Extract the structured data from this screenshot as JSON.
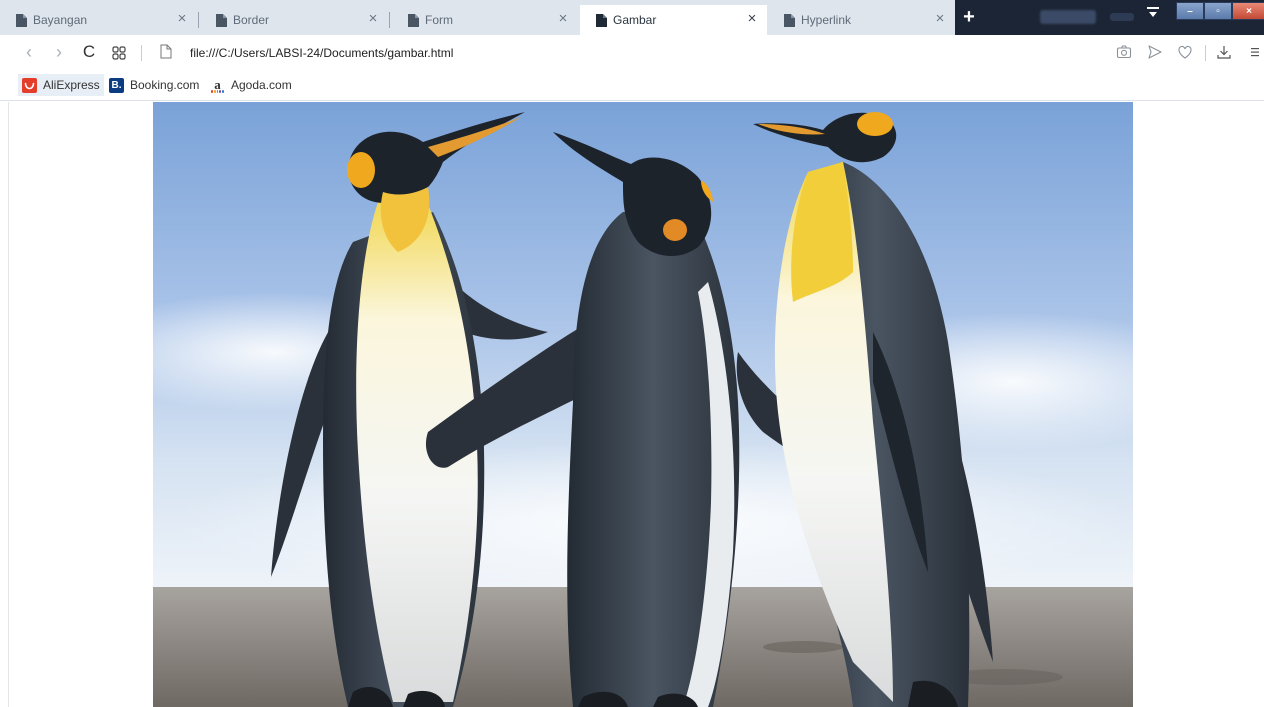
{
  "browser": {
    "tabs": [
      {
        "label": "Bayangan",
        "active": false
      },
      {
        "label": "Border",
        "active": false
      },
      {
        "label": "Form",
        "active": false
      },
      {
        "label": "Gambar",
        "active": true
      },
      {
        "label": "Hyperlink",
        "active": false
      }
    ],
    "new_tab_glyph": "+",
    "close_glyph": "×",
    "window_controls": {
      "minimize": "–",
      "maximize": "▫",
      "close": "×"
    }
  },
  "address_bar": {
    "url": "file:///C:/Users/LABSI-24/Documents/gambar.html",
    "back_glyph": "‹",
    "forward_glyph": "›",
    "reload_glyph": "C"
  },
  "bookmarks": [
    {
      "label": "AliExpress",
      "icon": "aliexpress-icon",
      "icon_text": ""
    },
    {
      "label": "Booking.com",
      "icon": "booking-icon",
      "icon_text": "B."
    },
    {
      "label": "Agoda.com",
      "icon": "agoda-icon",
      "icon_text": "a"
    }
  ],
  "content": {
    "image": "penguins-photo"
  },
  "colors": {
    "tabstrip_dark": "#1c2535",
    "tabstrip_light": "#dfe5ec",
    "aliexpress": "#e43d2a",
    "booking": "#0b3b80"
  }
}
